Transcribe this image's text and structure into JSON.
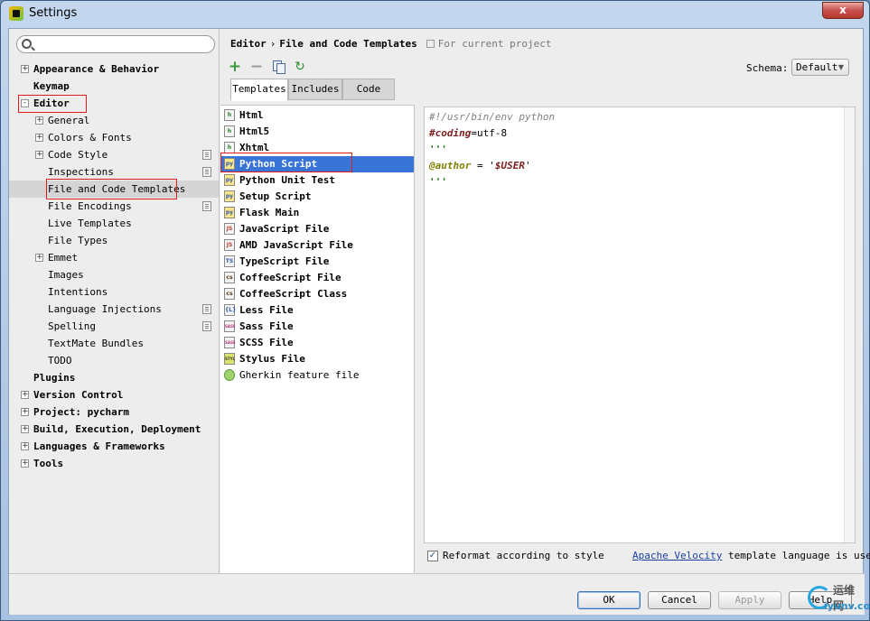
{
  "window": {
    "title": "Settings",
    "close_label": "x"
  },
  "search": {
    "value": "",
    "placeholder": ""
  },
  "sidebar": {
    "items": [
      {
        "label": "Appearance & Behavior",
        "expander": "+"
      },
      {
        "label": "Keymap"
      },
      {
        "label": "Editor",
        "expander": "-"
      },
      {
        "label": "General",
        "expander": "+"
      },
      {
        "label": "Colors & Fonts",
        "expander": "+"
      },
      {
        "label": "Code Style",
        "expander": "+"
      },
      {
        "label": "Inspections"
      },
      {
        "label": "File and Code Templates"
      },
      {
        "label": "File Encodings"
      },
      {
        "label": "Live Templates"
      },
      {
        "label": "File Types"
      },
      {
        "label": "Emmet",
        "expander": "+"
      },
      {
        "label": "Images"
      },
      {
        "label": "Intentions"
      },
      {
        "label": "Language Injections"
      },
      {
        "label": "Spelling"
      },
      {
        "label": "TextMate Bundles"
      },
      {
        "label": "TODO"
      },
      {
        "label": "Plugins"
      },
      {
        "label": "Version Control",
        "expander": "+"
      },
      {
        "label": "Project: pycharm",
        "expander": "+"
      },
      {
        "label": "Build, Execution, Deployment",
        "expander": "+"
      },
      {
        "label": "Languages & Frameworks",
        "expander": "+"
      },
      {
        "label": "Tools",
        "expander": "+"
      }
    ]
  },
  "header": {
    "breadcrumb_parent": "Editor",
    "breadcrumb_sep": "›",
    "breadcrumb_current": "File and Code Templates",
    "scope_note": "For current project"
  },
  "toolbar": {
    "add": "+",
    "remove": "−",
    "reset": "↻"
  },
  "schema": {
    "label": "Schema:",
    "value": "Default",
    "chevron": "▼"
  },
  "tabs": [
    {
      "label": "Templates"
    },
    {
      "label": "Includes"
    },
    {
      "label": "Code"
    }
  ],
  "templates": [
    {
      "label": "Html",
      "icon_text": "h"
    },
    {
      "label": "Html5",
      "icon_text": "h"
    },
    {
      "label": "Xhtml",
      "icon_text": "h"
    },
    {
      "label": "Python Script",
      "icon_text": "py"
    },
    {
      "label": "Python Unit Test",
      "icon_text": "py"
    },
    {
      "label": "Setup Script",
      "icon_text": "py"
    },
    {
      "label": "Flask Main",
      "icon_text": "py"
    },
    {
      "label": "JavaScript File",
      "icon_text": "JS"
    },
    {
      "label": "AMD JavaScript File",
      "icon_text": "JS"
    },
    {
      "label": "TypeScript File",
      "icon_text": "TS"
    },
    {
      "label": "CoffeeScript File",
      "icon_text": "cs"
    },
    {
      "label": "CoffeeScript Class",
      "icon_text": "cs"
    },
    {
      "label": "Less File",
      "icon_text": "{L}"
    },
    {
      "label": "Sass File",
      "icon_text": "SASS"
    },
    {
      "label": "SCSS File",
      "icon_text": "SASS"
    },
    {
      "label": "Stylus File",
      "icon_text": "STYL"
    },
    {
      "label": "Gherkin feature file",
      "icon_text": ""
    }
  ],
  "code": {
    "line1": "#!/usr/bin/env python",
    "line2_kw": "#coding",
    "line2_rest": "=utf-8",
    "line3": "'''",
    "line4_kw": "@author",
    "line4_eq": " = '",
    "line4_var": "$USER",
    "line4_end": "'",
    "line5": "'''"
  },
  "options": {
    "reformat_label": "Reformat according to style",
    "reformat_check": "✓",
    "velocity_link": "Apache Velocity",
    "velocity_rest": " template language is used"
  },
  "buttons": {
    "ok": "OK",
    "cancel": "Cancel",
    "apply": "Apply",
    "help": "Help"
  },
  "watermark": {
    "cn": "运维网",
    "en": "iyunv.com"
  },
  "colors": {
    "selection": "#3875d7",
    "highlight_box": "#e01b1b",
    "link": "#1a3fa3"
  }
}
